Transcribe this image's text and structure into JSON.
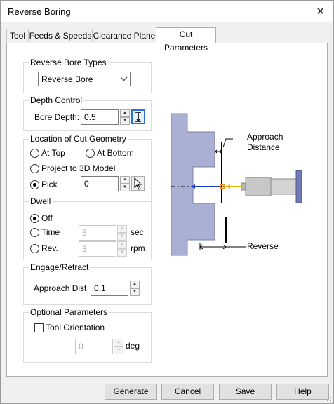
{
  "window": {
    "title": "Reverse Boring",
    "close_glyph": "✕"
  },
  "tabs": [
    {
      "label": "Tool"
    },
    {
      "label": "Feeds & Speeds"
    },
    {
      "label": "Clearance Plane"
    },
    {
      "label": "Cut Parameters"
    }
  ],
  "bore_types": {
    "title": "Reverse Bore Types",
    "selected": "Reverse Bore"
  },
  "depth_control": {
    "title": "Depth Control",
    "bore_depth_label": "Bore Depth:",
    "bore_depth_value": "0.5"
  },
  "location": {
    "title": "Location of Cut Geometry",
    "options": [
      {
        "label": "At Top",
        "selected": false
      },
      {
        "label": "At Bottom",
        "selected": false
      },
      {
        "label": "Project to 3D Model",
        "selected": false
      },
      {
        "label": "Pick",
        "selected": true
      }
    ],
    "pick_value": "0"
  },
  "dwell": {
    "title": "Dwell",
    "off_label": "Off",
    "time_label": "Time",
    "time_value": "5",
    "time_unit": "sec",
    "rev_label": "Rev.",
    "rev_value": "3",
    "rev_unit": "rpm",
    "selected": "Off"
  },
  "engage": {
    "title": "Engage/Retract",
    "approach_label": "Approach Dist",
    "approach_value": "0.1"
  },
  "optional": {
    "title": "Optional Parameters",
    "tool_orientation_label": "Tool Orientation",
    "tool_orientation_checked": false,
    "angle_value": "0",
    "angle_unit": "deg"
  },
  "diagram": {
    "approach_line1": "Approach",
    "approach_line2": "Distance",
    "reverse_label": "Reverse"
  },
  "buttons": {
    "generate": "Generate",
    "cancel": "Cancel",
    "save": "Save",
    "help": "Help"
  }
}
